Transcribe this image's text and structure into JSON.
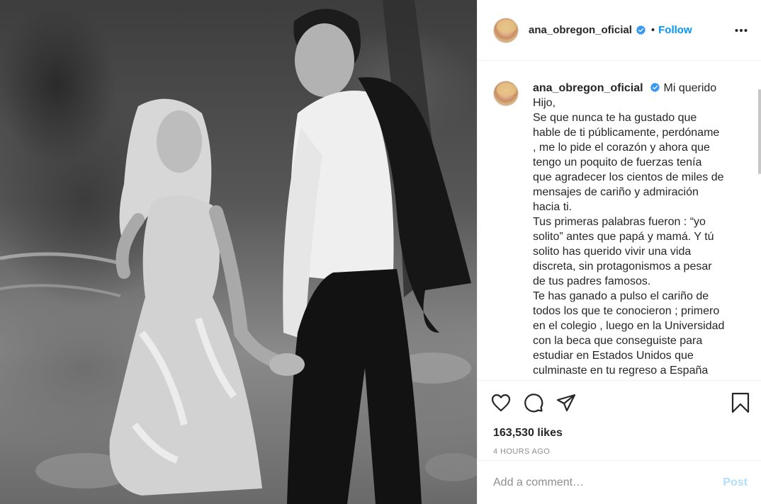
{
  "photo": {
    "alt": "Black and white photo of a woman and young man holding hands in a garden"
  },
  "header": {
    "username": "ana_obregon_oficial",
    "separator": "•",
    "follow_label": "Follow",
    "more_icon": "more-horizontal-icon",
    "verified_icon": "verified-badge-icon"
  },
  "caption": {
    "username": "ana_obregon_oficial",
    "text": "Mi querido\nHijo,\nSe que nunca te ha gustado que\nhable de ti públicamente, perdóname\n, me lo pide el corazón y ahora que\ntengo un poquito de fuerzas tenía\nque agradecer los cientos de miles de\nmensajes de cariño y admiración\nhacia ti.\nTus primeras palabras fueron : “yo\nsolito” antes que papá y mamá. Y tú\nsolito has querido vivir una vida\ndiscreta, sin protagonismos a pesar\nde tus padres famosos.\nTe has ganado a pulso el cariño de\ntodos los que te conocieron ; primero\nen el colegio , luego en la Universidad\ncon la beca que conseguiste para\nestudiar en Estados Unidos que\nculminaste en tu regreso a España"
  },
  "actions": {
    "like_icon": "heart-icon",
    "comment_icon": "comment-icon",
    "share_icon": "share-icon",
    "save_icon": "bookmark-icon"
  },
  "likes": "163,530 likes",
  "timestamp": "4 HOURS AGO",
  "comment": {
    "placeholder": "Add a comment…",
    "post_label": "Post"
  },
  "colors": {
    "accent": "#0095f6",
    "post_disabled": "#b2dffc",
    "text": "#262626",
    "muted": "#8e8e8e",
    "divider": "#efefef"
  }
}
